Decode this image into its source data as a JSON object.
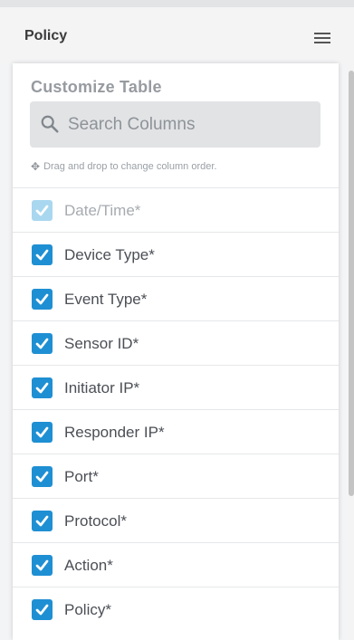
{
  "header": {
    "title": "Policy",
    "menu_icon": "hamburger-menu-icon"
  },
  "panel": {
    "title": "Customize Table",
    "search": {
      "placeholder": "Search Columns",
      "icon": "search-icon"
    },
    "hint": "Drag and drop to change column order.",
    "hint_icon": "move-icon",
    "columns": [
      {
        "label": "Date/Time",
        "required_mark": "*",
        "checked": true,
        "disabled": true
      },
      {
        "label": "Device Type",
        "required_mark": "*",
        "checked": true,
        "disabled": false
      },
      {
        "label": "Event Type",
        "required_mark": "*",
        "checked": true,
        "disabled": false
      },
      {
        "label": "Sensor ID",
        "required_mark": "*",
        "checked": true,
        "disabled": false
      },
      {
        "label": "Initiator IP",
        "required_mark": "*",
        "checked": true,
        "disabled": false
      },
      {
        "label": "Responder IP",
        "required_mark": "*",
        "checked": true,
        "disabled": false
      },
      {
        "label": "Port",
        "required_mark": "*",
        "checked": true,
        "disabled": false
      },
      {
        "label": "Protocol",
        "required_mark": "*",
        "checked": true,
        "disabled": false
      },
      {
        "label": "Action",
        "required_mark": "*",
        "checked": true,
        "disabled": false
      },
      {
        "label": "Policy",
        "required_mark": "*",
        "checked": true,
        "disabled": false
      }
    ]
  },
  "colors": {
    "checkbox": "#1f8fd3",
    "checkbox_disabled": "#a9d7f0",
    "text": "#4b4f55",
    "muted_text": "#a6abb0"
  }
}
